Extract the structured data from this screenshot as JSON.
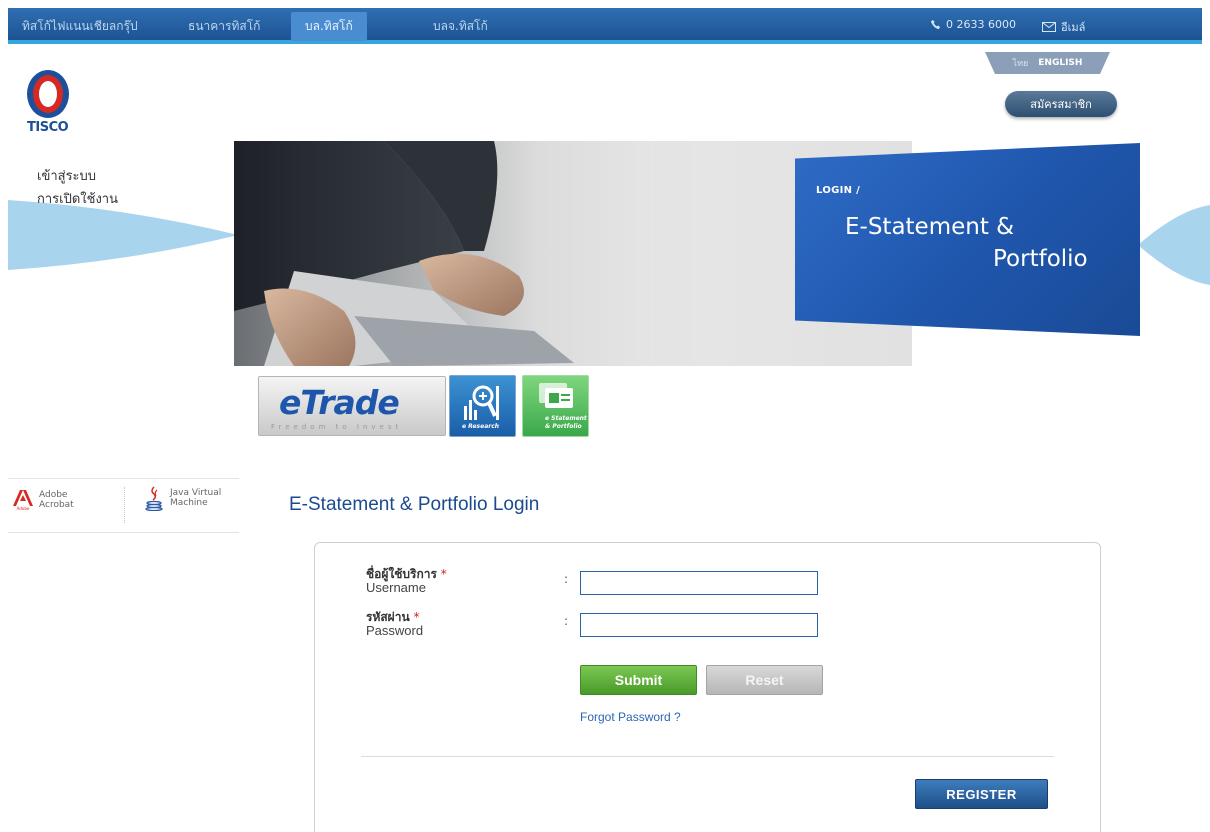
{
  "topnav": {
    "items": [
      {
        "label": "ทิสโก้ไฟแนนเชียลกรุ๊ป"
      },
      {
        "label": "ธนาคารทิสโก้"
      },
      {
        "label": "บล.ทิสโก้"
      },
      {
        "label": "บลจ.ทิสโก้"
      }
    ],
    "active_index": 2,
    "phone": "0 2633 6000",
    "email": "อีเมล์"
  },
  "logo": {
    "text": "TISCO"
  },
  "language": {
    "thai": "ไทย",
    "english": "ENGLISH",
    "active": "thai"
  },
  "member_button": "สมัครสมาชิก",
  "side_menu": {
    "line1": "เข้าสู่ระบบ",
    "line2": "การเปิดใช้งาน"
  },
  "banner": {
    "label": "LOGIN /",
    "title_line1": "E-Statement &",
    "title_line2": "Portfolio"
  },
  "products": {
    "etrade": {
      "title": "eTrade",
      "subtitle": "Freedom to Invest"
    },
    "eresearch": {
      "label": "e Research"
    },
    "estatement": {
      "label_line1": "e Statement",
      "label_line2": "& Portfolio"
    }
  },
  "software": [
    {
      "label": "Adobe\nAcrobat",
      "icon": "adobe-icon"
    },
    {
      "label": "Java Virtual\nMachine",
      "icon": "java-icon"
    }
  ],
  "login": {
    "heading": "E-Statement & Portfolio Login",
    "username": {
      "label_th": "ชื่อผู้ใช้บริการ",
      "label_en": "Username",
      "value": "",
      "required_mark": "*"
    },
    "password": {
      "label_th": "รหัสผ่าน",
      "label_en": "Password",
      "value": "",
      "required_mark": "*"
    },
    "colon": ":",
    "submit_label": "Submit",
    "reset_label": "Reset",
    "forgot_label": "Forgot Password ?",
    "register_label": "REGISTER"
  },
  "colors": {
    "nav_bg": "#1d5394",
    "nav_accent": "#35a6dc",
    "banner_blue": "#1f56ac",
    "heading": "#1c4a8e",
    "submit_green": "#4a9a2a",
    "register_blue": "#1e4f88"
  }
}
